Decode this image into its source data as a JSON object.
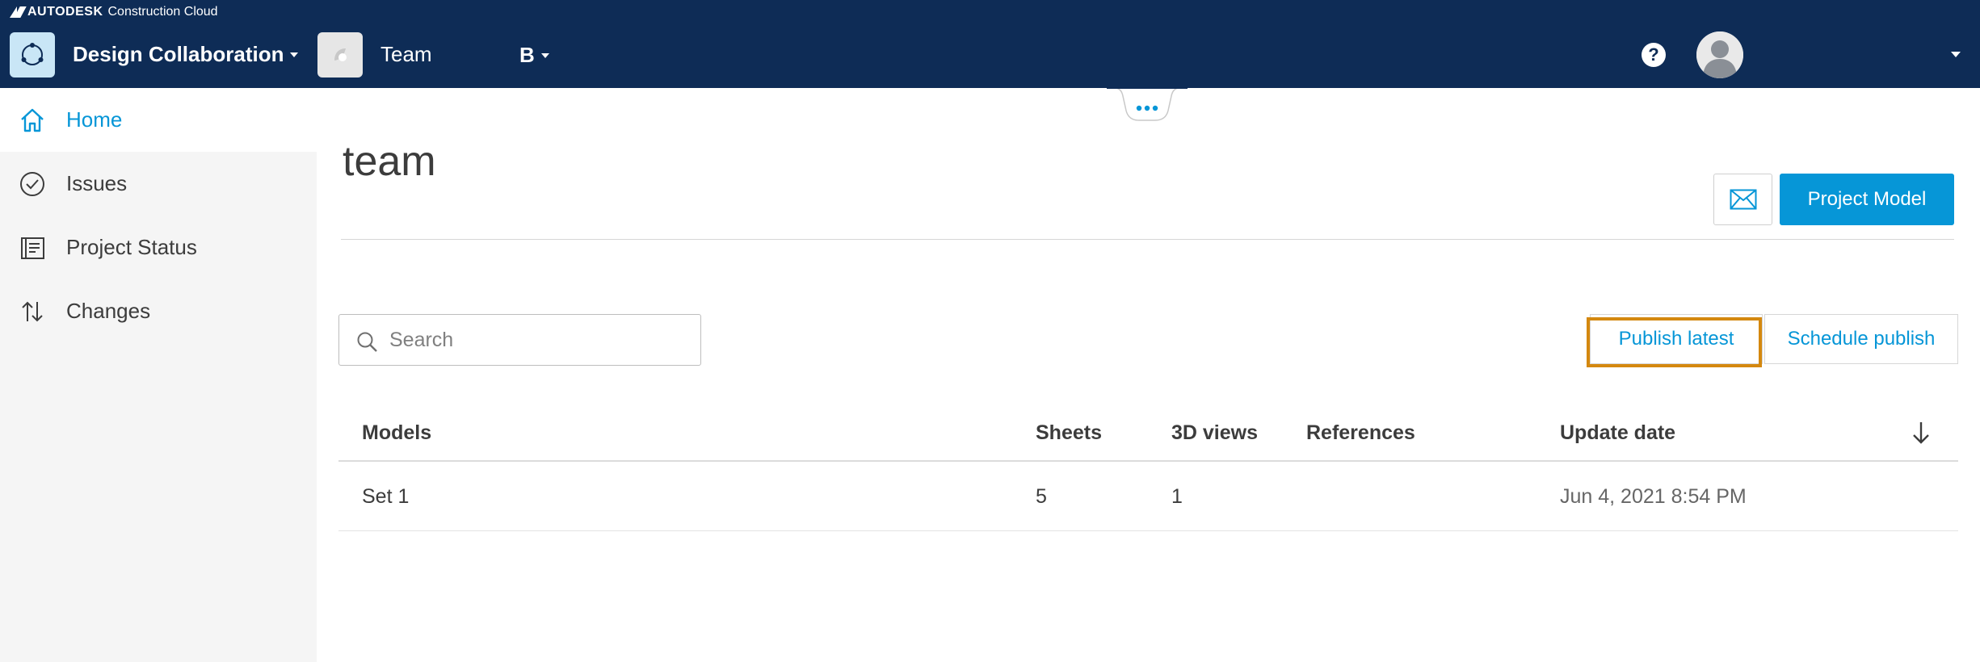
{
  "brand": {
    "strong": "AUTODESK",
    "light": "Construction Cloud"
  },
  "header": {
    "app_name": "Design Collaboration",
    "team_name": "Team",
    "switcher_letter": "B",
    "help_symbol": "?"
  },
  "sidebar": {
    "items": [
      {
        "label": "Home",
        "icon": "home-icon",
        "active": true
      },
      {
        "label": "Issues",
        "icon": "check-circle-icon",
        "active": false
      },
      {
        "label": "Project Status",
        "icon": "report-icon",
        "active": false
      },
      {
        "label": "Changes",
        "icon": "up-down-arrows-icon",
        "active": false
      }
    ]
  },
  "main": {
    "title": "team",
    "primary_button": "Project Model",
    "search": {
      "placeholder": "Search",
      "value": ""
    },
    "publish_latest": "Publish latest",
    "schedule_publish": "Schedule publish"
  },
  "table": {
    "columns": [
      "Models",
      "Sheets",
      "3D views",
      "References",
      "Update date"
    ],
    "rows": [
      {
        "model": "Set 1",
        "sheets": "5",
        "views": "1",
        "references": "",
        "date": "Jun 4, 2021 8:54 PM"
      }
    ]
  },
  "colors": {
    "header_bg": "#0e2c56",
    "accent": "#0696d7",
    "highlight": "#d4880f",
    "sidebar_bg": "#f5f5f5"
  }
}
